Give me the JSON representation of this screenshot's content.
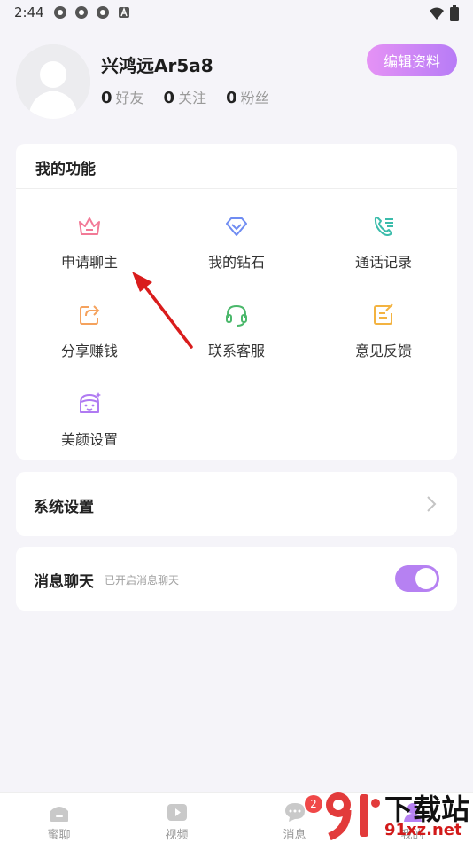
{
  "status_bar": {
    "time": "2:44"
  },
  "profile": {
    "username": "兴鸿远Ar5a8",
    "edit_button": "编辑资料",
    "stats": [
      {
        "count": "0",
        "label": "好友"
      },
      {
        "count": "0",
        "label": "关注"
      },
      {
        "count": "0",
        "label": "粉丝"
      }
    ]
  },
  "functions": {
    "title": "我的功能",
    "items": [
      {
        "label": "申请聊主",
        "icon": "crown-icon",
        "color": "#f27a97"
      },
      {
        "label": "我的钻石",
        "icon": "diamond-icon",
        "color": "#6f8cf2"
      },
      {
        "label": "通话记录",
        "icon": "phone-log-icon",
        "color": "#3bbcab"
      },
      {
        "label": "分享赚钱",
        "icon": "share-icon",
        "color": "#f5a25d"
      },
      {
        "label": "联系客服",
        "icon": "headset-icon",
        "color": "#4bb86b"
      },
      {
        "label": "意见反馈",
        "icon": "feedback-icon",
        "color": "#f3b341"
      },
      {
        "label": "美颜设置",
        "icon": "beauty-face-icon",
        "color": "#b07af2"
      }
    ]
  },
  "settings": {
    "label": "系统设置"
  },
  "message_chat": {
    "label": "消息聊天",
    "sub": "已开启消息聊天",
    "enabled": true
  },
  "bottom_nav": {
    "items": [
      {
        "label": "蜜聊",
        "icon": "home-icon"
      },
      {
        "label": "视频",
        "icon": "video-icon"
      },
      {
        "label": "消息",
        "icon": "chat-icon",
        "badge": "2"
      },
      {
        "label": "我的",
        "icon": "profile-icon"
      }
    ]
  },
  "watermark": {
    "big": "下载站",
    "small": "91xz.net"
  },
  "colors": {
    "accent": "#b681f2",
    "badge": "#f04848"
  }
}
